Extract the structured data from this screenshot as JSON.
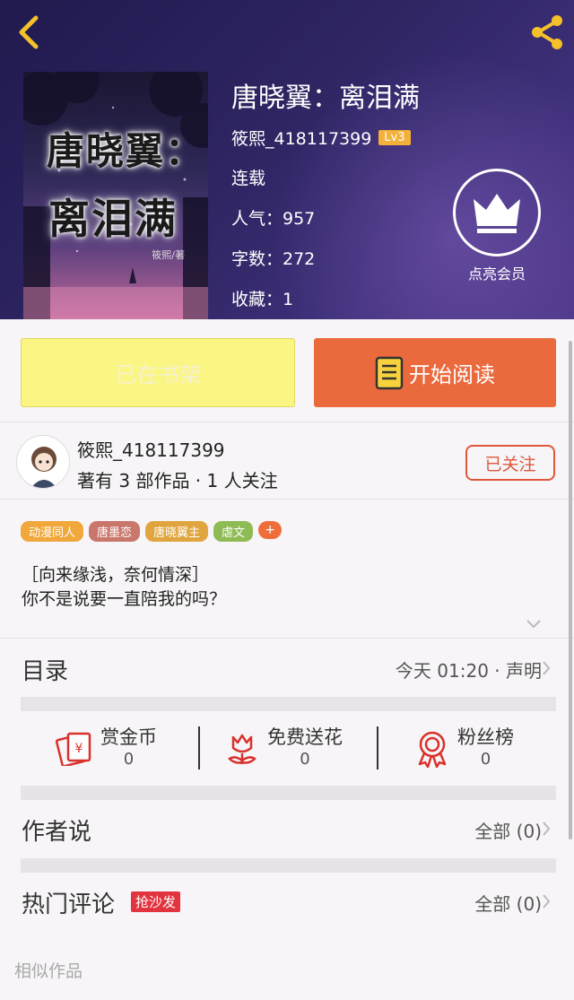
{
  "book": {
    "title": "唐晓翼：离泪满",
    "cover_line1": "唐晓翼：",
    "cover_line2": "离泪满",
    "cover_byline": "筱熙/著",
    "author": "筱熙_418117399",
    "level": "Lv3",
    "status": "连载",
    "popularity": "人气：957",
    "word_count": "字数：272",
    "favorites": "收藏：1"
  },
  "vip": {
    "label": "点亮会员"
  },
  "actions": {
    "shelf_label": "已在书架",
    "read_label": "开始阅读"
  },
  "author_card": {
    "name": "筱熙_418117399",
    "stats": "著有 3 部作品 · 1 人关注",
    "follow_label": "已关注"
  },
  "tags": [
    {
      "label": "动漫同人",
      "color": "#f0a83c"
    },
    {
      "label": "唐墨恋",
      "color": "#c9766b"
    },
    {
      "label": "唐晓翼主",
      "color": "#e0a53e"
    },
    {
      "label": "虐文",
      "color": "#8fbb55"
    }
  ],
  "tag_more": "+",
  "intro": {
    "line1": "［向来缘浅，奈何情深］",
    "line2": "你不是说要一直陪我的吗？"
  },
  "catalog": {
    "title": "目录",
    "update": "今天 01:20 · 声明"
  },
  "stats": [
    {
      "label": "赏金币",
      "value": "0",
      "icon": "red-envelope-icon"
    },
    {
      "label": "免费送花",
      "value": "0",
      "icon": "flower-icon"
    },
    {
      "label": "粉丝榜",
      "value": "0",
      "icon": "medal-icon"
    }
  ],
  "author_says": {
    "title": "作者说",
    "count": "全部 (0)"
  },
  "comments": {
    "title": "热门评论",
    "badge": "抢沙发",
    "count": "全部 (0)"
  },
  "similar": {
    "title": "相似作品"
  },
  "colors": {
    "accent": "#ea6a3e",
    "header_bg": "#2e2562",
    "shelf_bg": "#fbf584",
    "red": "#e0563b"
  }
}
